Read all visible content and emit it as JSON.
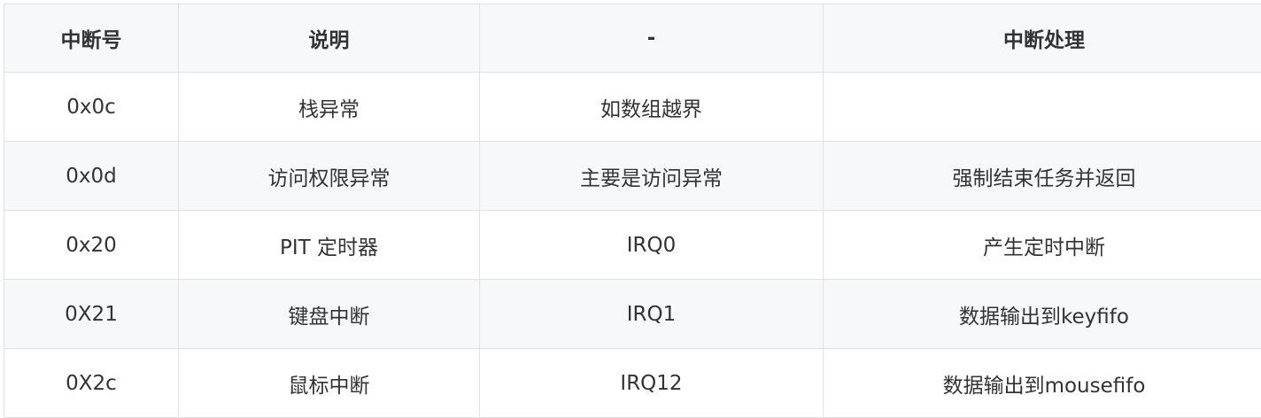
{
  "table": {
    "headers": [
      "中断号",
      "说明",
      "-",
      "中断处理"
    ],
    "rows": [
      [
        "0x0c",
        "栈异常",
        "如数组越界",
        ""
      ],
      [
        "0x0d",
        "访问权限异常",
        "主要是访问异常",
        "强制结束任务并返回"
      ],
      [
        "0x20",
        "PIT 定时器",
        "IRQ0",
        "产生定时中断"
      ],
      [
        "0X21",
        "键盘中断",
        "IRQ1",
        "数据输出到keyfifo"
      ],
      [
        "0X2c",
        "鼠标中断",
        "IRQ12",
        "数据输出到mousefifo"
      ]
    ]
  },
  "colors": {
    "header_bg": "#f6f8fa",
    "stripe_bg": "#f6f8fa",
    "border": "#dfe2e5",
    "text": "#333333"
  }
}
